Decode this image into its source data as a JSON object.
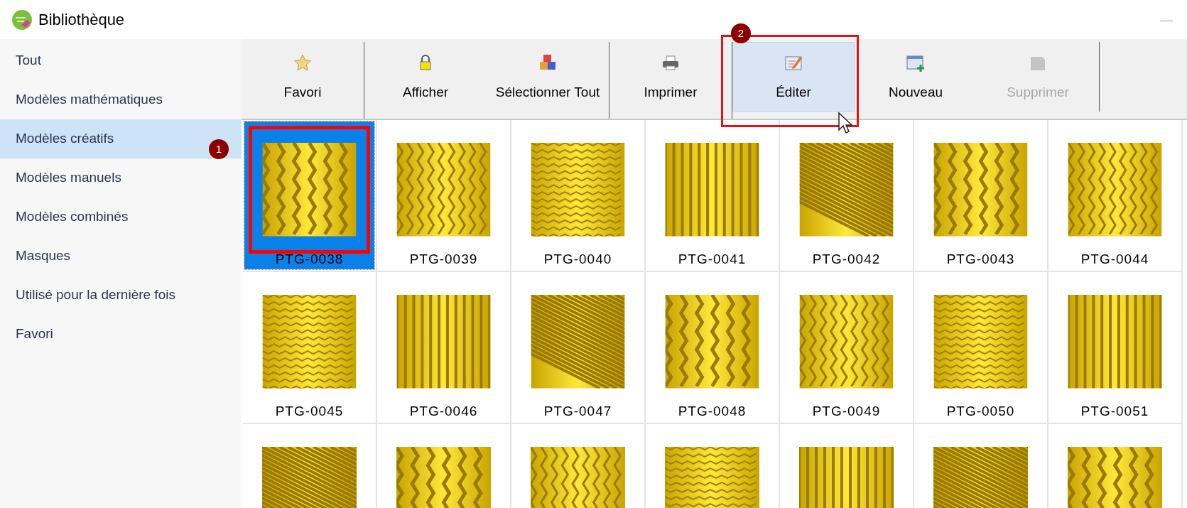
{
  "window": {
    "title": "Bibliothèque"
  },
  "sidebar": {
    "items": [
      {
        "label": "Tout",
        "selected": false
      },
      {
        "label": "Modèles mathématiques",
        "selected": false
      },
      {
        "label": "Modèles créatifs",
        "selected": true,
        "callout": "1"
      },
      {
        "label": "Modèles manuels",
        "selected": false
      },
      {
        "label": "Modèles combinés",
        "selected": false
      },
      {
        "label": "Masques",
        "selected": false
      },
      {
        "label": "Utilisé pour la dernière fois",
        "selected": false
      },
      {
        "label": "Favori",
        "selected": false
      }
    ]
  },
  "toolbar": {
    "groups": [
      {
        "buttons": [
          {
            "label": "Favori",
            "disabled": false,
            "hovered": false
          }
        ]
      },
      {
        "buttons": [
          {
            "label": "Afficher",
            "disabled": false,
            "hovered": false
          },
          {
            "label": "Sélectionner Tout",
            "disabled": false,
            "hovered": false
          }
        ]
      },
      {
        "buttons": [
          {
            "label": "Imprimer",
            "disabled": false,
            "hovered": false
          }
        ]
      },
      {
        "buttons": [
          {
            "label": "Éditer",
            "disabled": false,
            "hovered": true,
            "highlight": true,
            "callout": "2"
          },
          {
            "label": "Nouveau",
            "disabled": false,
            "hovered": false
          },
          {
            "label": "Supprimer",
            "disabled": true,
            "hovered": false
          }
        ]
      }
    ]
  },
  "grid": {
    "items": [
      {
        "label": "PTG-0038",
        "selected": true,
        "highlight": true
      },
      {
        "label": "PTG-0039",
        "selected": false
      },
      {
        "label": "PTG-0040",
        "selected": false
      },
      {
        "label": "PTG-0041",
        "selected": false
      },
      {
        "label": "PTG-0042",
        "selected": false
      },
      {
        "label": "PTG-0043",
        "selected": false
      },
      {
        "label": "PTG-0044",
        "selected": false
      },
      {
        "label": "PTG-0045",
        "selected": false
      },
      {
        "label": "PTG-0046",
        "selected": false
      },
      {
        "label": "PTG-0047",
        "selected": false
      },
      {
        "label": "PTG-0048",
        "selected": false
      },
      {
        "label": "PTG-0049",
        "selected": false
      },
      {
        "label": "PTG-0050",
        "selected": false
      },
      {
        "label": "PTG-0051",
        "selected": false
      },
      {
        "selected": false
      },
      {
        "selected": false
      },
      {
        "selected": false
      },
      {
        "selected": false
      },
      {
        "selected": false
      },
      {
        "selected": false
      },
      {
        "selected": false
      }
    ]
  }
}
